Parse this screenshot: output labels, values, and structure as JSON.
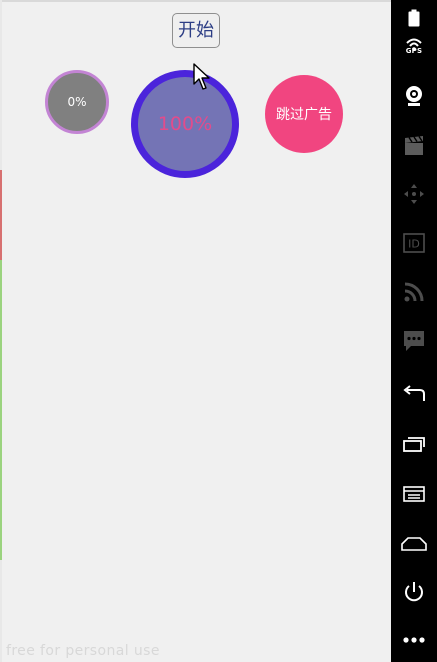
{
  "app": {
    "start_button_label": "开始",
    "progress_small_text": "0%",
    "progress_large_text": "100%",
    "skip_ad_label": "跳过广告",
    "watermark_text": "free for personal use"
  },
  "colors": {
    "screen_background": "#f0f0f0",
    "start_button_text": "#2d3e85",
    "small_circle_fill": "#808080",
    "small_circle_ring": "#c384d4",
    "large_circle_fill": "#7474b5",
    "large_circle_ring": "#4b24db",
    "large_circle_text": "#e24c8c",
    "skip_ad_fill": "#f14580",
    "toolbar_background": "#000000"
  },
  "emulator_toolbar": {
    "items": [
      {
        "name": "battery-icon"
      },
      {
        "name": "gps-icon",
        "label": "GPS"
      },
      {
        "name": "webcam-icon"
      },
      {
        "name": "video-record-icon"
      },
      {
        "name": "move-dpad-icon"
      },
      {
        "name": "device-id-icon"
      },
      {
        "name": "rss-feed-icon"
      },
      {
        "name": "sms-message-icon"
      },
      {
        "name": "back-icon"
      },
      {
        "name": "recent-apps-icon"
      },
      {
        "name": "menu-icon"
      },
      {
        "name": "home-icon"
      },
      {
        "name": "power-icon"
      },
      {
        "name": "more-icon"
      }
    ]
  }
}
